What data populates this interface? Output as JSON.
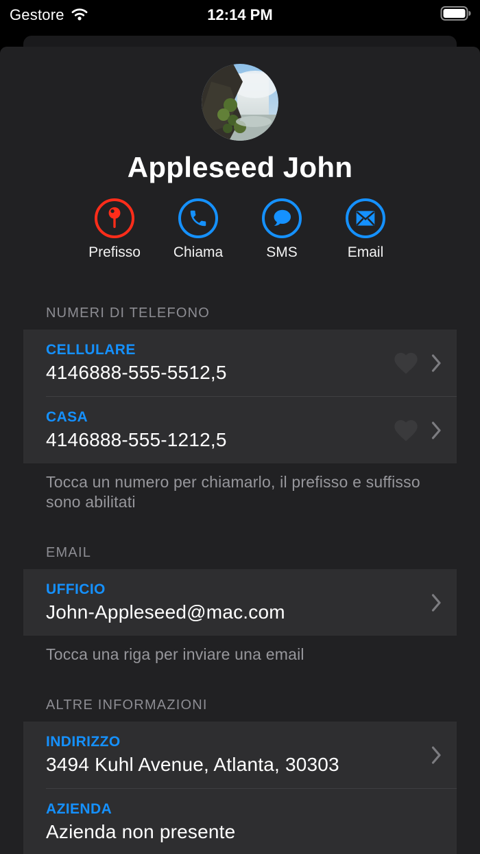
{
  "status_bar": {
    "carrier": "Gestore",
    "time": "12:14 PM",
    "wifi": "wifi-icon",
    "battery": "battery-full-icon"
  },
  "profile": {
    "name": "Appleseed John",
    "avatar": "waterfall-photo"
  },
  "actions": [
    {
      "label": "Prefisso",
      "icon": "pin-icon",
      "color": "#ff2d1a"
    },
    {
      "label": "Chiama",
      "icon": "phone-icon",
      "color": "#1591ff"
    },
    {
      "label": "SMS",
      "icon": "speech-bubble-icon",
      "color": "#1591ff"
    },
    {
      "label": "Email",
      "icon": "envelope-icon",
      "color": "#1591ff"
    }
  ],
  "sections": {
    "phones": {
      "header": "NUMERI DI TELEFONO",
      "rows": [
        {
          "label": "CELLULARE",
          "value": "4146888-555-5512,5",
          "favorite": false
        },
        {
          "label": "CASA",
          "value": "4146888-555-1212,5",
          "favorite": false
        }
      ],
      "hint": "Tocca un numero per chiamarlo, il prefisso e suffisso sono abilitati"
    },
    "email": {
      "header": "EMAIL",
      "rows": [
        {
          "label": "UFFICIO",
          "value": "John-Appleseed@mac.com"
        }
      ],
      "hint": "Tocca una riga per inviare una email"
    },
    "other": {
      "header": "ALTRE INFORMAZIONI",
      "rows": [
        {
          "label": "INDIRIZZO",
          "value": "3494 Kuhl Avenue, Atlanta, 30303"
        },
        {
          "label": "AZIENDA",
          "value": "Azienda non presente"
        }
      ]
    }
  },
  "colors": {
    "accent_blue": "#1591ff",
    "accent_red": "#ff2d1a",
    "sheet_bg": "#212123",
    "card_bg": "#2e2e30",
    "muted_text": "#8d8d93",
    "hint_text": "#97979c"
  }
}
